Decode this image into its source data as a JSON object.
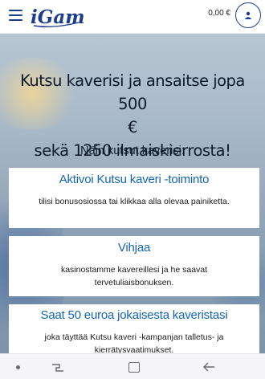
{
  "header": {
    "logo_text": "iGame",
    "balance": "0,00 €"
  },
  "hero": {
    "title_line1": "Kutsu kaverisi ja ansaitse jopa 500",
    "title_line2": "€",
    "title_line3": "sekä 1250 ilmaiskierrosta!",
    "subtitle": "Näin kutsut kaverisi:"
  },
  "steps": [
    {
      "title": "Aktivoi Kutsu kaveri -toiminto",
      "text": "tilisi bonusosiossa tai klikkaa alla olevaa painiketta."
    },
    {
      "title": "Vihjaa",
      "text": "kasinostamme kavereillesi ja he saavat tervetuliaisbonuksen."
    },
    {
      "title": "Saat 50 euroa jokaisesta kaveristasi",
      "text": "joka täyttää Kutsu kaveri -kampanjan talletus- ja kierrätysvaatimukset."
    }
  ],
  "colors": {
    "brand_blue": "#1a3d8f",
    "link_blue": "#1565b6"
  },
  "icons": {
    "menu": "hamburger-menu-icon",
    "profile": "user-icon",
    "nav_recent": "recent-apps-icon",
    "nav_home": "home-icon",
    "nav_back": "back-arrow-icon"
  }
}
